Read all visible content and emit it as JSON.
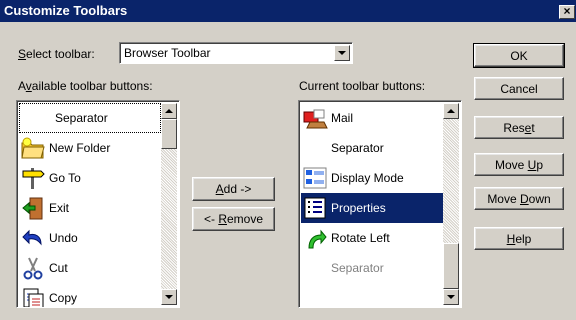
{
  "window": {
    "title": "Customize Toolbars",
    "close_label": "×"
  },
  "select_toolbar": {
    "label_prefix": "",
    "label_mnemonic": "S",
    "label_rest": "elect toolbar:",
    "value": "Browser Toolbar"
  },
  "available": {
    "label_pre": "A",
    "label_mnemonic": "v",
    "label_rest": "ailable toolbar buttons:",
    "items": [
      {
        "label": "Separator",
        "icon": "none"
      },
      {
        "label": "New Folder",
        "icon": "new-folder-icon"
      },
      {
        "label": "Go To",
        "icon": "go-to-icon"
      },
      {
        "label": "Exit",
        "icon": "exit-icon"
      },
      {
        "label": "Undo",
        "icon": "undo-icon"
      },
      {
        "label": "Cut",
        "icon": "cut-icon"
      },
      {
        "label": "Copy",
        "icon": "copy-icon"
      }
    ]
  },
  "current": {
    "label": "Current toolbar buttons:",
    "items": [
      {
        "label": "Mail",
        "icon": "mail-icon"
      },
      {
        "label": "Separator",
        "icon": "none"
      },
      {
        "label": "Display Mode",
        "icon": "display-mode-icon"
      },
      {
        "label": "Properties",
        "icon": "properties-icon",
        "selected": true
      },
      {
        "label": "Rotate Left",
        "icon": "rotate-left-icon"
      },
      {
        "label": "Separator",
        "icon": "none",
        "disabled": true
      }
    ]
  },
  "middle_buttons": {
    "add_pre": "",
    "add_mnemonic": "A",
    "add_rest": "dd ->",
    "remove_pre": "<- ",
    "remove_mnemonic": "R",
    "remove_rest": "emove"
  },
  "right_buttons": {
    "ok": "OK",
    "cancel": "Cancel",
    "reset_pre": "Res",
    "reset_mnemonic": "e",
    "reset_rest": "t",
    "moveup_pre": "Move ",
    "moveup_mnemonic": "U",
    "moveup_rest": "p",
    "movedown_pre": "Move ",
    "movedown_mnemonic": "D",
    "movedown_rest": "own",
    "help_pre": "",
    "help_mnemonic": "H",
    "help_rest": "elp"
  },
  "colors": {
    "face": "#d4d0c8",
    "title": "#0a246a",
    "selection": "#0a246a"
  }
}
